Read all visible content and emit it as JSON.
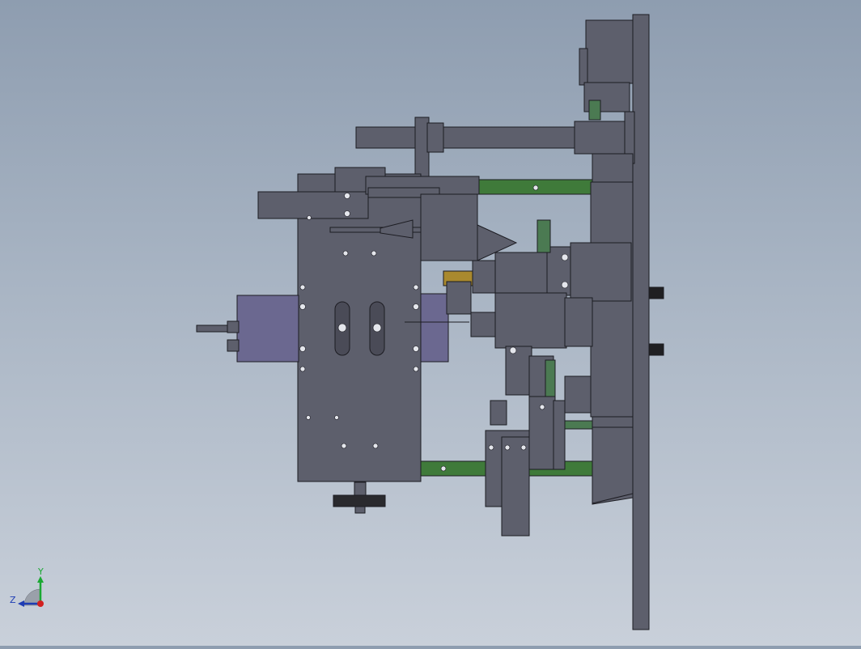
{
  "scene": {
    "background_top": "#8e9db0",
    "background_bottom": "#c9d0da",
    "part_color": "#5d5f6c",
    "edge_color": "#1c1c22",
    "frame_rail_color": "#3f7a3a",
    "motor_color": "#6b6890",
    "brass_color": "#a9892e"
  },
  "triad": {
    "y_label": "Y",
    "z_label": "Z",
    "y_color": "#1aa832",
    "z_color": "#1e3cb4",
    "x_color": "#d22020"
  }
}
